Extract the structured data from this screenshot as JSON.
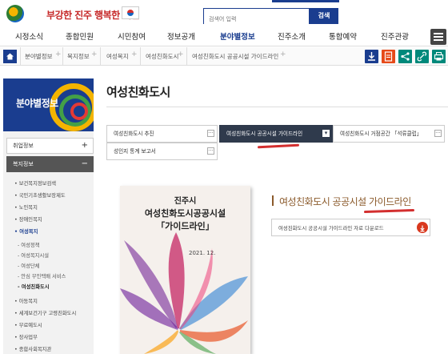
{
  "header": {
    "logo_text": "진주",
    "slogan": "부강한 진주 행복한 시민",
    "search_placeholder": "검색어 입력",
    "search_button": "검색"
  },
  "gnb": {
    "items": [
      "시정소식",
      "종합민원",
      "시민참여",
      "정보공개",
      "분야별정보",
      "진주소개",
      "통합예약",
      "진주관광"
    ],
    "active_index": 4
  },
  "breadcrumb": {
    "items": [
      "분야별정보",
      "복지정보",
      "여성복지",
      "여성친화도시",
      "여성친화도시 공공시설 가이드라인"
    ],
    "tools": [
      {
        "icon": "download-icon",
        "color": "#1a3d8f"
      },
      {
        "icon": "print-doc-icon",
        "color": "#e64a19"
      },
      {
        "icon": "share-icon",
        "color": "#00897b"
      },
      {
        "icon": "link-icon",
        "color": "#00897b"
      },
      {
        "icon": "print-icon",
        "color": "#00897b"
      }
    ]
  },
  "sidebar": {
    "banner_title": "분야별정보",
    "menus": [
      {
        "label": "취업정보",
        "toggle": "+",
        "open": false
      },
      {
        "label": "복지정보",
        "toggle": "−",
        "open": true
      }
    ],
    "sub_items": [
      "보건복지정보검색",
      "국민기초생활보장제도",
      "노인복지",
      "장애인복지",
      "여성복지"
    ],
    "sub_active_index": 4,
    "sub2_items": [
      "여성정책",
      "여성복지시설",
      "여성단체",
      "안심 무인택배 서비스",
      "여성친화도시"
    ],
    "sub2_active_index": 4,
    "sub_items_after": [
      "아동복지",
      "세계보건기구 고령친화도시",
      "무료예도시",
      "장사업무",
      "종합사회복지관"
    ]
  },
  "main": {
    "title": "여성친화도시",
    "tabs": [
      {
        "label": "여성친화도시 추진",
        "btn": "···",
        "active": false
      },
      {
        "label": "여성친화도시 공공시설 가이드라인",
        "btn": "▾",
        "active": true
      },
      {
        "label": "여성친화도시 거점공간 「석류클럽」",
        "btn": "···",
        "active": false
      },
      {
        "label": "성인지 통계 보고서",
        "btn": "···",
        "active": false
      }
    ],
    "cover": {
      "line1": "진주시",
      "line2": "여성친화도시공공시설",
      "line3": "「가이드라인」",
      "date": "2021. 12."
    },
    "guide_title": "여성친화도시 공공시설 가이드라인",
    "download_text": "여성친화도시 공공시설 가이드라인 자료 다운로드",
    "download_icon": "download-icon"
  }
}
